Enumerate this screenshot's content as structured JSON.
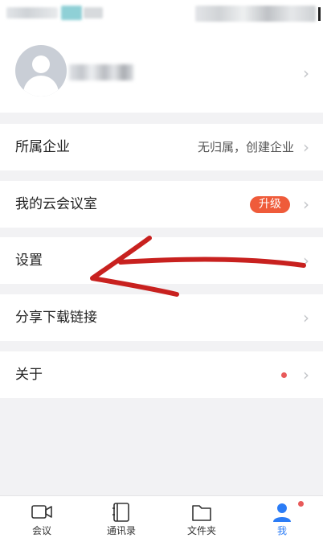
{
  "profile": {
    "name": ""
  },
  "menu": {
    "enterprise": {
      "label": "所属企业",
      "value": "无归属，创建企业"
    },
    "cloud_room": {
      "label": "我的云会议室",
      "badge": "升级"
    },
    "settings": {
      "label": "设置"
    },
    "share": {
      "label": "分享下载链接"
    },
    "about": {
      "label": "关于"
    }
  },
  "tabbar": {
    "items": [
      {
        "label": "会议",
        "icon": "video-camera-icon"
      },
      {
        "label": "通讯录",
        "icon": "contacts-book-icon"
      },
      {
        "label": "文件夹",
        "icon": "folder-icon"
      },
      {
        "label": "我",
        "icon": "person-icon",
        "active": true
      }
    ]
  },
  "colors": {
    "accent": "#2b7cf6",
    "badge": "#ef5b3a",
    "notification_dot": "#e85a5a",
    "annotation_arrow": "#c8211f"
  }
}
